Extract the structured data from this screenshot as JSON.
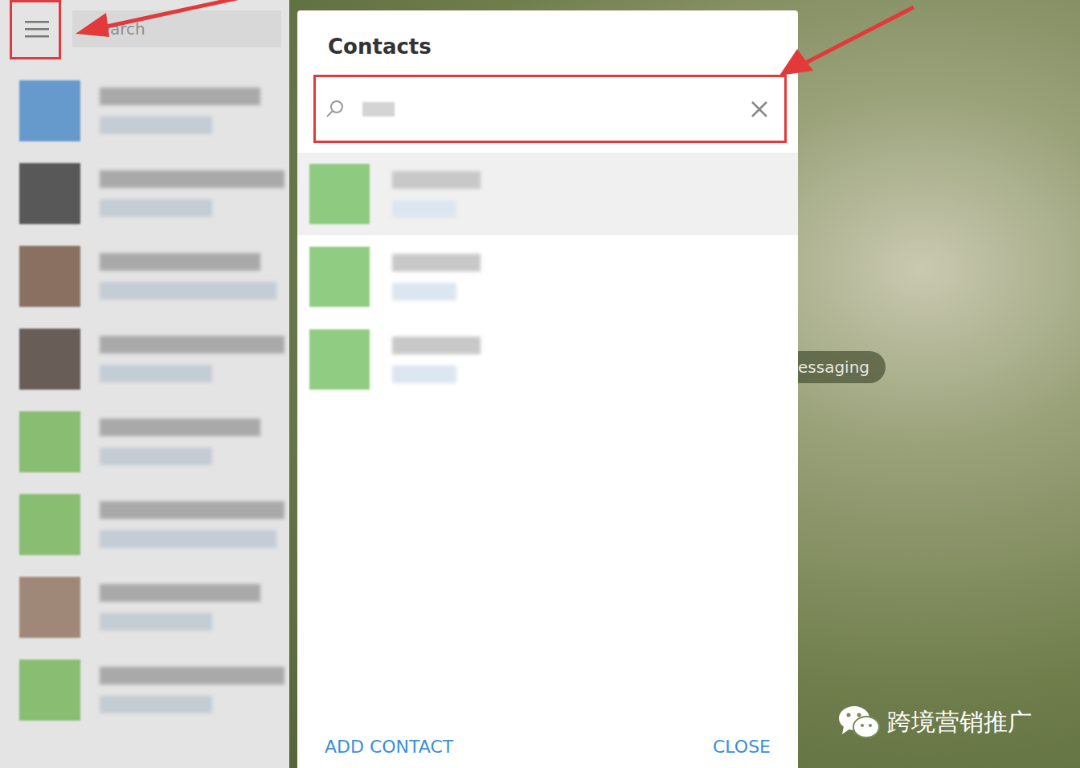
{
  "sidebar": {
    "search_placeholder": "Search",
    "chats": [
      {
        "color": "#3d82c4"
      },
      {
        "color": "#2a2a2a"
      },
      {
        "color": "#6b4a35"
      },
      {
        "color": "#3f3029"
      },
      {
        "color": "#6ab04c"
      },
      {
        "color": "#6ab04c"
      },
      {
        "color": "#8a6a55"
      },
      {
        "color": "#6ab04c"
      }
    ]
  },
  "dialog": {
    "title": "Contacts",
    "contacts": [
      {
        "color": "#7dc46c",
        "selected": true
      },
      {
        "color": "#7dc46c",
        "selected": false
      },
      {
        "color": "#7dc46c",
        "selected": false
      }
    ],
    "buttons": [
      {
        "label": "ADD CONTACT"
      },
      {
        "label": "CLOSE"
      }
    ]
  },
  "background": {
    "hint": "essaging"
  },
  "watermark": {
    "text": "跨境营销推广"
  }
}
